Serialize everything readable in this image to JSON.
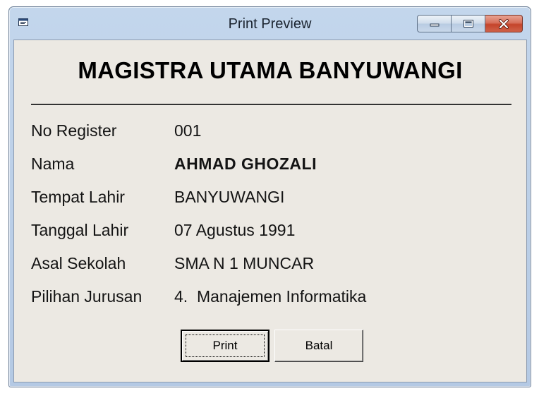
{
  "window": {
    "title": "Print Preview",
    "controls": {
      "minimize": "minimize",
      "maximize": "maximize",
      "close": "close"
    }
  },
  "form": {
    "heading": "MAGISTRA UTAMA BANYUWANGI",
    "fields": [
      {
        "label": "No Register",
        "value": "001"
      },
      {
        "label": "Nama",
        "value": "AHMAD GHOZALI"
      },
      {
        "label": "Tempat Lahir",
        "value": "BANYUWANGI"
      },
      {
        "label": "Tanggal Lahir",
        "value": "07 Agustus 1991"
      },
      {
        "label": "Asal Sekolah",
        "value": "SMA N 1 MUNCAR"
      },
      {
        "label": "Pilihan Jurusan",
        "value": "4.  Manajemen Informatika"
      }
    ]
  },
  "buttons": {
    "print": "Print",
    "batal": "Batal"
  },
  "colors": {
    "titlebar": "#b9cde5",
    "client": "#ece9e3",
    "close": "#c4442b"
  }
}
